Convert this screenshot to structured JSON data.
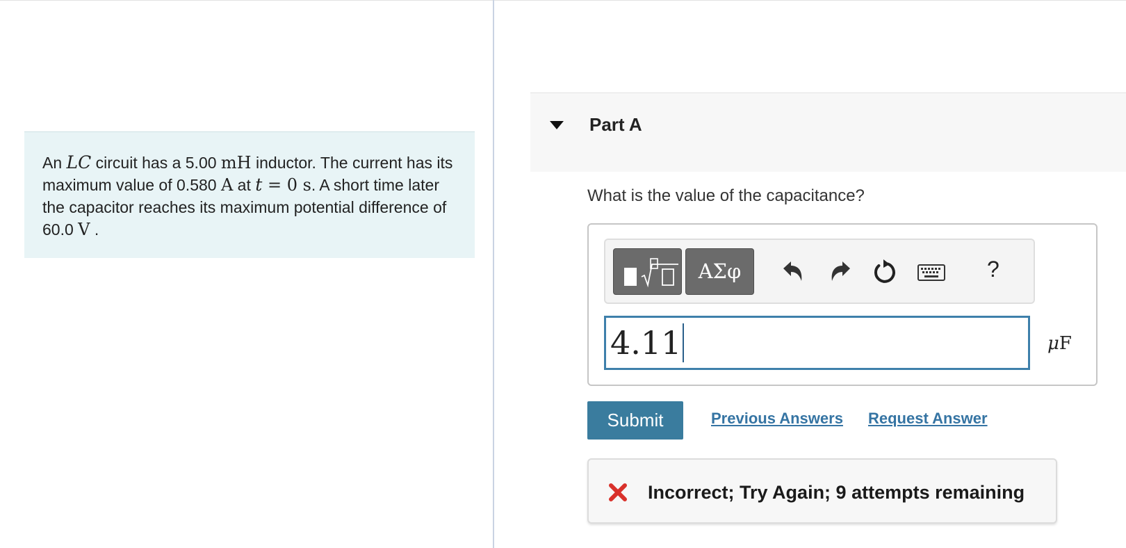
{
  "problem": {
    "t1": "An ",
    "lc": "LC",
    "t2": " circuit has a 5.00 ",
    "mh": "mH",
    "t3": " inductor. The current has its maximum value of 0.580 ",
    "a": "A",
    "t4": " at ",
    "t_var": "t",
    "eq": " = ",
    "zero_s": "0 s",
    "t5": ". A short time later the capacitor reaches its maximum potential difference of 60.0 ",
    "v": "V",
    "t6": " ."
  },
  "part": {
    "title": "Part A",
    "question": "What is the value of the capacitance?"
  },
  "toolbar": {
    "greek_label": "ΑΣφ",
    "help_label": "?"
  },
  "answer": {
    "value": "4.11",
    "unit_prefix": "μ",
    "unit": "F"
  },
  "actions": {
    "submit_label": "Submit",
    "previous_answers_label": "Previous Answers",
    "request_answer_label": "Request Answer"
  },
  "feedback": {
    "message": "Incorrect; Try Again; 9 attempts remaining"
  },
  "colors": {
    "problem_bg": "#e8f4f6",
    "submit_bg": "#3a7c9e",
    "link": "#3574a3",
    "input_border": "#3e80ab",
    "error_icon": "#d9312b"
  }
}
